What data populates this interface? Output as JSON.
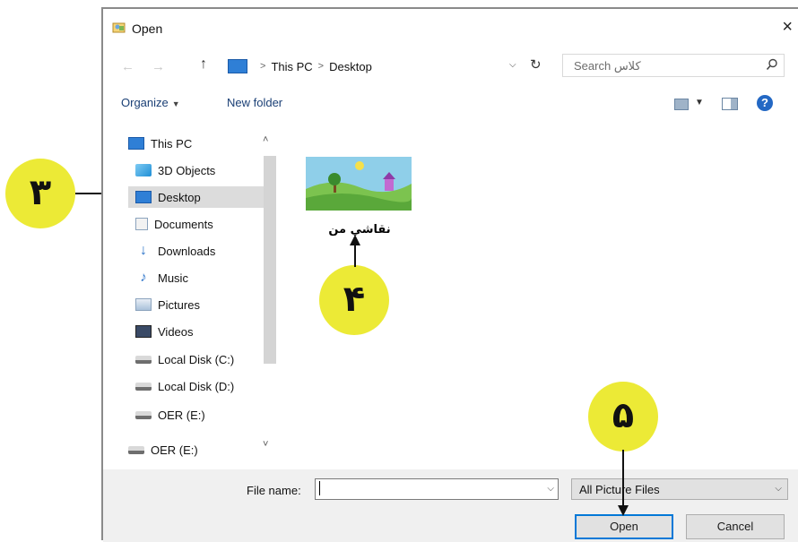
{
  "window": {
    "title": "Open",
    "close_glyph": "×"
  },
  "navigation": {
    "back_glyph": "←",
    "forward_glyph": "→",
    "up_glyph": "↑",
    "breadcrumb": [
      "This PC",
      "Desktop"
    ],
    "crumb_separator": ">",
    "refresh_glyph": "↻",
    "search_placeholder": "Search كلاس"
  },
  "toolbar": {
    "organize_label": "Organize",
    "new_folder_label": "New folder",
    "help_glyph": "?"
  },
  "sidebar": {
    "items": [
      {
        "label": "This PC",
        "icon": "computer-icon"
      },
      {
        "label": "3D Objects",
        "icon": "cube-icon"
      },
      {
        "label": "Desktop",
        "icon": "desktop-icon",
        "selected": true
      },
      {
        "label": "Documents",
        "icon": "document-icon"
      },
      {
        "label": "Downloads",
        "icon": "download-arrow-icon"
      },
      {
        "label": "Music",
        "icon": "music-note-icon"
      },
      {
        "label": "Pictures",
        "icon": "pictures-icon"
      },
      {
        "label": "Videos",
        "icon": "video-icon"
      },
      {
        "label": "Local Disk (C:)",
        "icon": "system-drive-icon"
      },
      {
        "label": "Local Disk (D:)",
        "icon": "drive-icon"
      },
      {
        "label": "OER (E:)",
        "icon": "drive-icon"
      },
      {
        "label": "OER (E:)",
        "icon": "drive-icon"
      }
    ]
  },
  "content": {
    "files": [
      {
        "name": "نقاشي من",
        "icon": "image-thumbnail-icon"
      }
    ]
  },
  "footer": {
    "file_name_label": "File name:",
    "file_name_value": "",
    "file_type_selected": "All Picture Files",
    "open_button_label": "Open",
    "cancel_button_label": "Cancel"
  },
  "annotations": {
    "callouts": [
      "۳",
      "۴",
      "۵"
    ],
    "callout_color": "#ecea36",
    "selection_color": "#dcdcdc",
    "accent_color": "#0078d7"
  }
}
